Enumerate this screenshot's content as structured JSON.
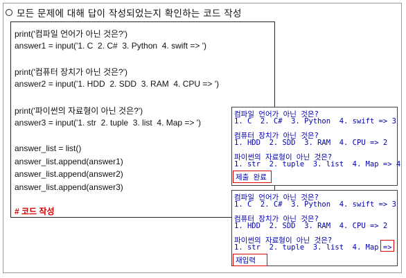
{
  "heading": "모든 문제에 대해 답이 작성되었는지 확인하는 코드 작성",
  "code": {
    "lines": [
      "print('컴파일 언어가 아닌 것은?')",
      "answer1 = input('1. C  2. C#  3. Python  4. swift => ')",
      "print('컴퓨터 장치가 아닌 것은?')",
      "answer2 = input('1. HDD  2. SDD  3. RAM  4. CPU => ')",
      "print('파이썬의 자료형이 아닌 것은?')",
      "answer3 = input('1. str  2. tuple  3. list  4. Map => ')",
      "answer_list = list()",
      "answer_list.append(answer1)",
      "answer_list.append(answer2)",
      "answer_list.append(answer3)"
    ],
    "comment": "# 코드 작성"
  },
  "console1": {
    "lines": [
      "컴파일 언어가 아닌 것은?",
      "1. C  2. C#  3. Python  4. swift => 3",
      "컴퓨터 장치가 아닌 것은?",
      "1. HDD  2. SDD  3. RAM  4. CPU => 2",
      "파이썬의 자료형이 아닌 것은?",
      "1. str  2. tuple  3. list  4. Map => 4"
    ],
    "status": "제출 완료"
  },
  "console2": {
    "lines": [
      "컴파일 언어가 아닌 것은?",
      "1. C  2. C#  3. Python  4. swift => 3",
      "컴퓨터 장치가 아닌 것은?",
      "1. HDD  2. SDD  3. RAM  4. CPU => 2",
      "파이썬의 자료형이 아닌 것은?",
      "1. str  2. tuple  3. list  4. Map =>"
    ],
    "status": "재입력"
  }
}
